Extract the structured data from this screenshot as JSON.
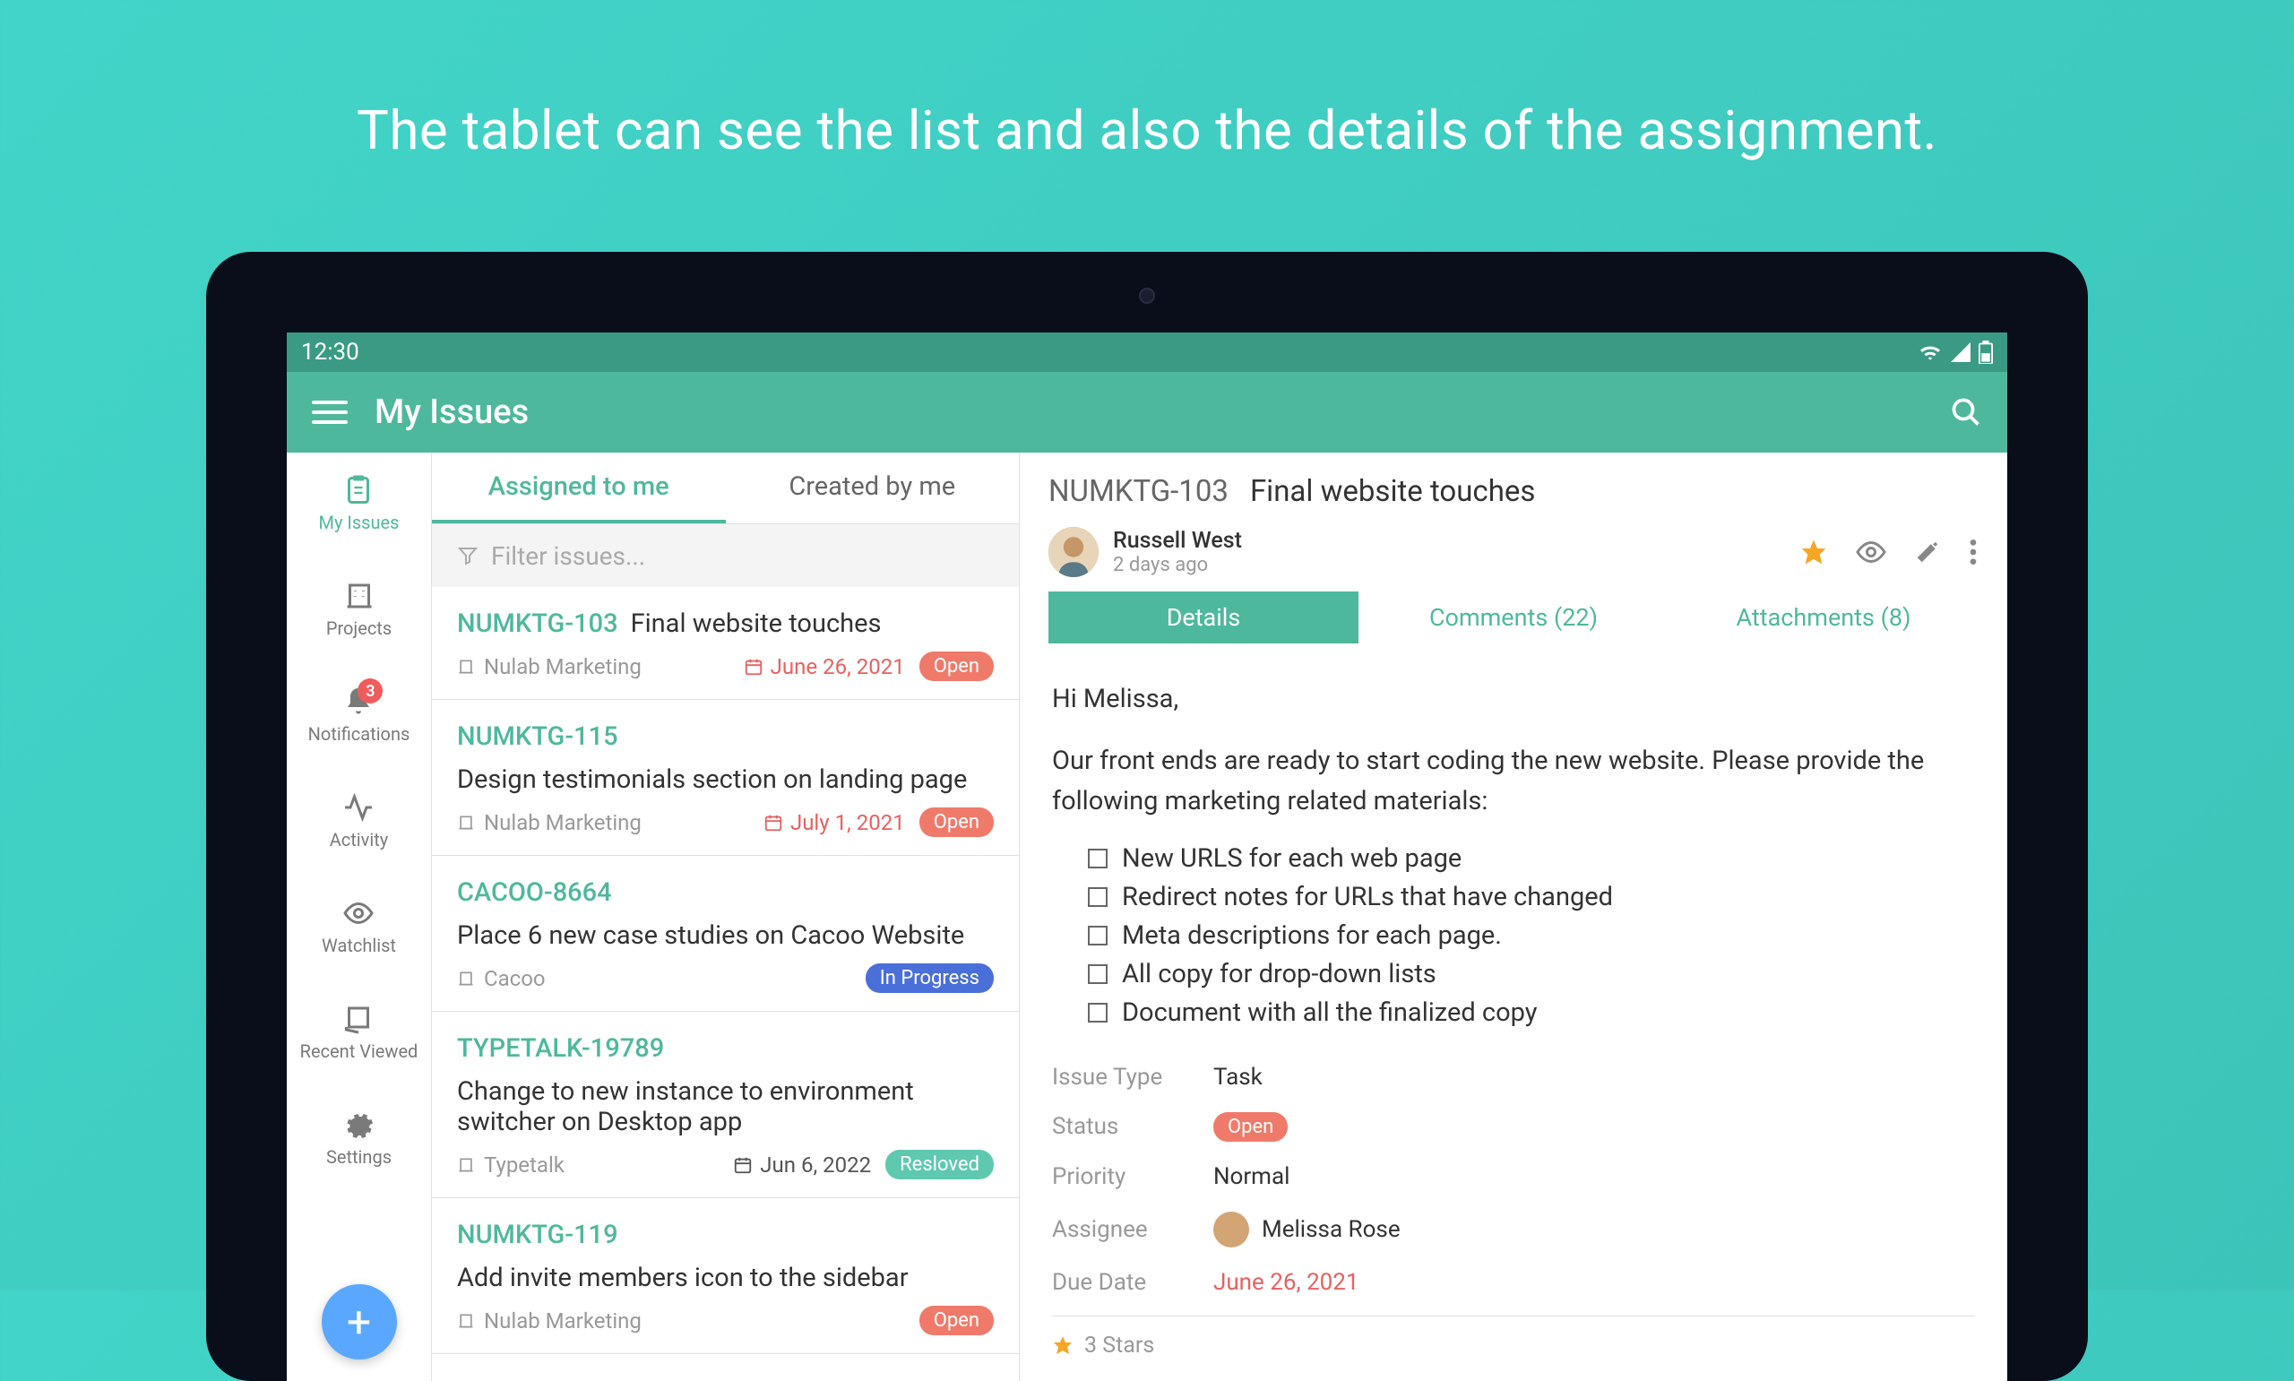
{
  "headline": "The tablet can see the list and also the details of the assignment.",
  "statusBar": {
    "time": "12:30"
  },
  "appBar": {
    "title": "My Issues"
  },
  "sidebar": {
    "items": [
      {
        "label": "My Issues",
        "active": true
      },
      {
        "label": "Projects"
      },
      {
        "label": "Notifications",
        "badge": "3"
      },
      {
        "label": "Activity"
      },
      {
        "label": "Watchlist"
      },
      {
        "label": "Recent Viewed"
      },
      {
        "label": "Settings"
      }
    ]
  },
  "listTabs": {
    "assigned": "Assigned to me",
    "created": "Created by me"
  },
  "filterPlaceholder": "Filter issues...",
  "issues": [
    {
      "key": "NUMKTG-103",
      "title": "Final website touches",
      "project": "Nulab Marketing",
      "date": "June 26, 2021",
      "dateRed": true,
      "status": "Open",
      "statusClass": "status-open"
    },
    {
      "key": "NUMKTG-115",
      "title": "Design testimonials section on landing page",
      "project": "Nulab Marketing",
      "date": "July 1, 2021",
      "dateRed": true,
      "status": "Open",
      "statusClass": "status-open"
    },
    {
      "key": "CACOO-8664",
      "title": "Place 6 new case studies on Cacoo Website",
      "project": "Cacoo",
      "date": "",
      "status": "In Progress",
      "statusClass": "status-progress"
    },
    {
      "key": "TYPETALK-19789",
      "title": "Change to new instance to environment switcher on Desktop app",
      "project": "Typetalk",
      "date": "Jun 6, 2022",
      "dateRed": false,
      "status": "Resloved",
      "statusClass": "status-resolved"
    },
    {
      "key": "NUMKTG-119",
      "title": "Add invite members icon to the sidebar",
      "project": "Nulab Marketing",
      "date": "",
      "status": "Open",
      "statusClass": "status-open"
    }
  ],
  "detail": {
    "key": "NUMKTG-103",
    "title": "Final website touches",
    "author": "Russell West",
    "time": "2 days ago",
    "tabs": {
      "details": "Details",
      "comments": "Comments (22)",
      "attachments": "Attachments (8)"
    },
    "greeting": "Hi Melissa,",
    "intro": "Our front ends are ready to start coding the new website. Please provide the following marketing related materials:",
    "checklist": [
      "New URLS for each web page",
      "Redirect notes for URLs that have changed",
      "Meta descriptions for each page.",
      "All copy for drop-down lists",
      "Document with all the finalized copy"
    ],
    "meta": {
      "issueTypeLabel": "Issue Type",
      "issueType": "Task",
      "statusLabel": "Status",
      "status": "Open",
      "priorityLabel": "Priority",
      "priority": "Normal",
      "assigneeLabel": "Assignee",
      "assignee": "Melissa Rose",
      "dueDateLabel": "Due Date",
      "dueDate": "June 26, 2021"
    },
    "stars": "3 Stars"
  }
}
